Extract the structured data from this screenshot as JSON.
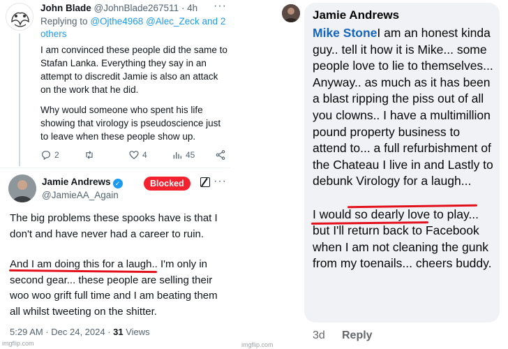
{
  "tweet1": {
    "name": "John Blade",
    "handle": "@JohnBlade267511",
    "time": "· 4h",
    "more": "···",
    "reply_prefix": "Replying to",
    "reply_mentions": "@Ojthe4968 @Alec_Zeck and 2 others",
    "text_p1": "I am convinced these people did the same to Stafan Lanka. Everything they say in an attempt to discredit Jamie is also an attack on the work that he did.",
    "text_p2": "Why would someone who spent his life showing that virology is pseudoscience just to leave when these people show up.",
    "reply_count": "2",
    "retweet_count": "",
    "like_count": "4",
    "view_count": "45"
  },
  "tweet2": {
    "name": "Jamie Andrews",
    "handle": "@JamieAA_Again",
    "blocked_label": "Blocked",
    "more": "···",
    "text_p1": "The big problems these spooks have is that I don't and have never had a career to ruin.",
    "text_underlined": "And I am doing this for a laugh",
    "text_p2_rest": ".. I'm only in second gear... these people are selling their woo woo grift full time and I am beating them all whilst tweeting on the shitter.",
    "timestamp": "5:29 AM · Dec 24, 2024 · ",
    "views_count": "31",
    "views_label": " Views"
  },
  "fb_comment": {
    "name": "Jamie Andrews",
    "mention": "Mike Stone",
    "text_part1": "I am an honest kinda guy.. tell it how it is Mike... some people love to lie to themselves... Anyway.. as much as it has been a blast ripping the piss out of all you clowns.. I have a multimillion pound property business to attend to... a full refurbishment of the Chateau I live in ",
    "text_underlined": "and Lastly to debunk Virology for a laugh...",
    "text_part2": "I would so dearly love to play... but I'll return back to Facebook when I am not cleaning the gunk from my toenails... cheers buddy.",
    "time": "3d",
    "reply_label": "Reply"
  },
  "watermarks": {
    "left": "imgflip.com",
    "right": "imgflip.com"
  },
  "colors": {
    "twitter_blue": "#1d9bf0",
    "blocked_red": "#f4212e",
    "underline_red": "#e3101c",
    "fb_mention": "#1565c0",
    "fb_bubble": "#f0f2f5"
  }
}
